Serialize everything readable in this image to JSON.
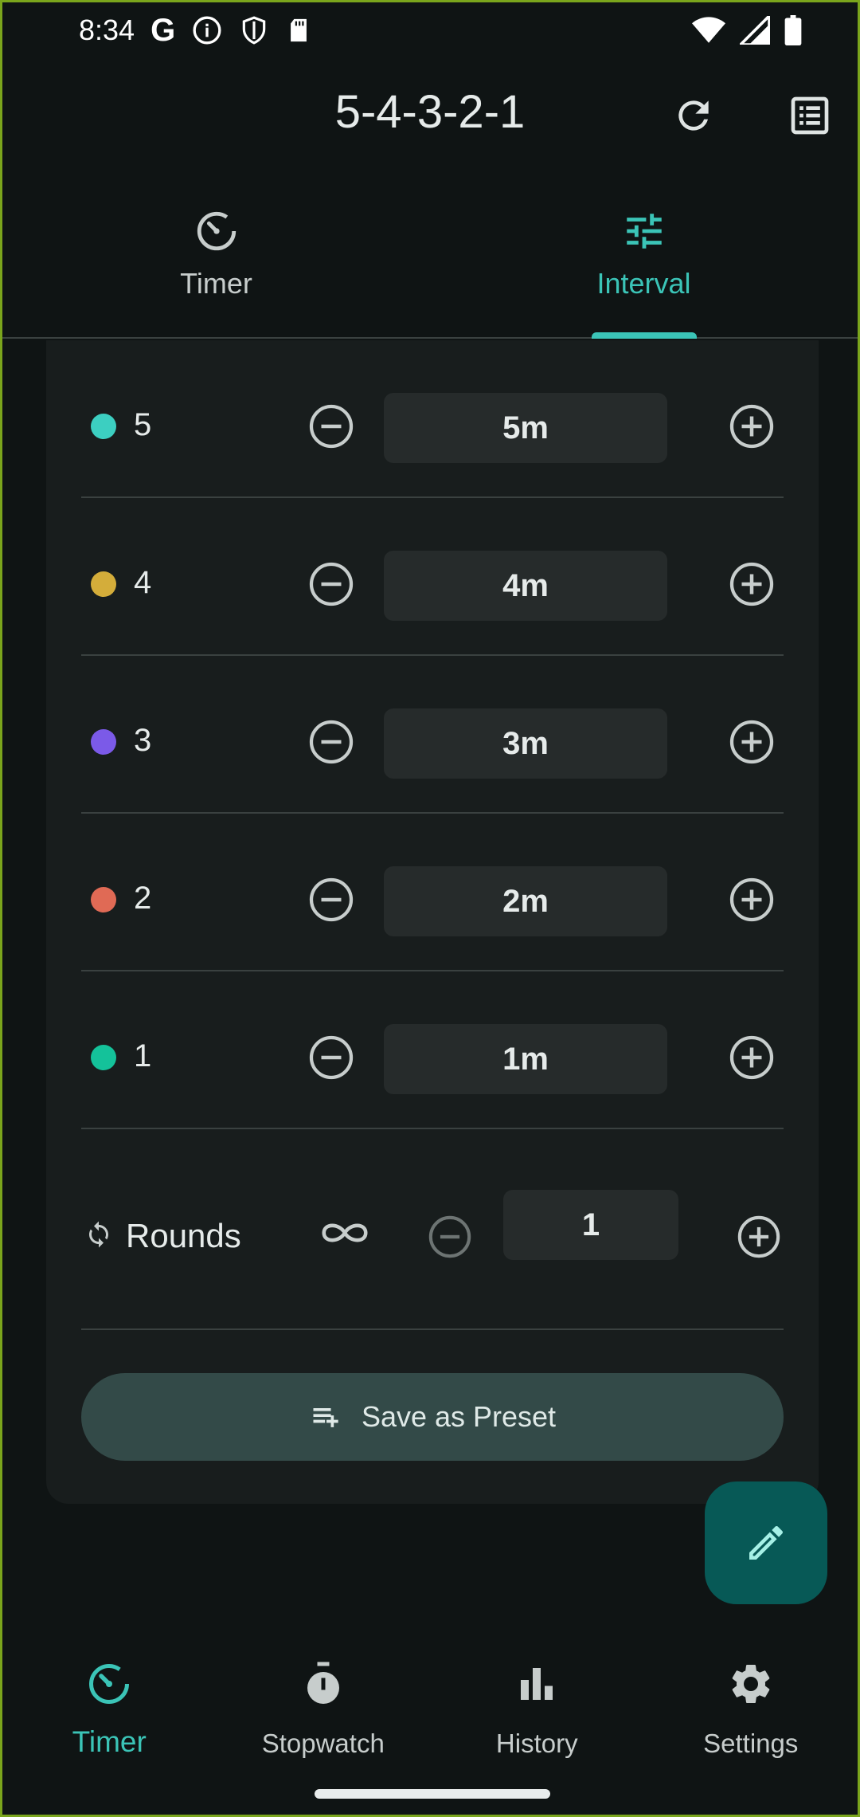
{
  "status_bar": {
    "time": "8:34",
    "icons": [
      "google-icon",
      "info-icon",
      "shield-icon",
      "sdcard-icon",
      "wifi-icon",
      "cell-signal-icon",
      "battery-icon"
    ]
  },
  "app_bar": {
    "title": "5-4-3-2-1",
    "actions": [
      "reset-icon",
      "list-icon"
    ]
  },
  "tabs": [
    {
      "label": "Timer",
      "icon": "timer-icon",
      "active": false
    },
    {
      "label": "Interval",
      "icon": "tune-icon",
      "active": true
    }
  ],
  "intervals": [
    {
      "name": "5",
      "value": "5m",
      "color": "#3ccfc1"
    },
    {
      "name": "4",
      "value": "4m",
      "color": "#d4ad3a"
    },
    {
      "name": "3",
      "value": "3m",
      "color": "#7b5ae8"
    },
    {
      "name": "2",
      "value": "2m",
      "color": "#e06a55"
    },
    {
      "name": "1",
      "value": "1m",
      "color": "#14c29a"
    }
  ],
  "rounds": {
    "label": "Rounds",
    "value": "1"
  },
  "save_button": {
    "label": "Save as Preset"
  },
  "bottom_nav": [
    {
      "label": "Timer",
      "icon": "timer-icon",
      "active": true
    },
    {
      "label": "Stopwatch",
      "icon": "stopwatch-icon",
      "active": false
    },
    {
      "label": "History",
      "icon": "bar-chart-icon",
      "active": false
    },
    {
      "label": "Settings",
      "icon": "gear-icon",
      "active": false
    }
  ],
  "colors": {
    "accent": "#3bc4b7",
    "background": "#0f1414",
    "card": "#181d1d",
    "fab": "#075956"
  }
}
